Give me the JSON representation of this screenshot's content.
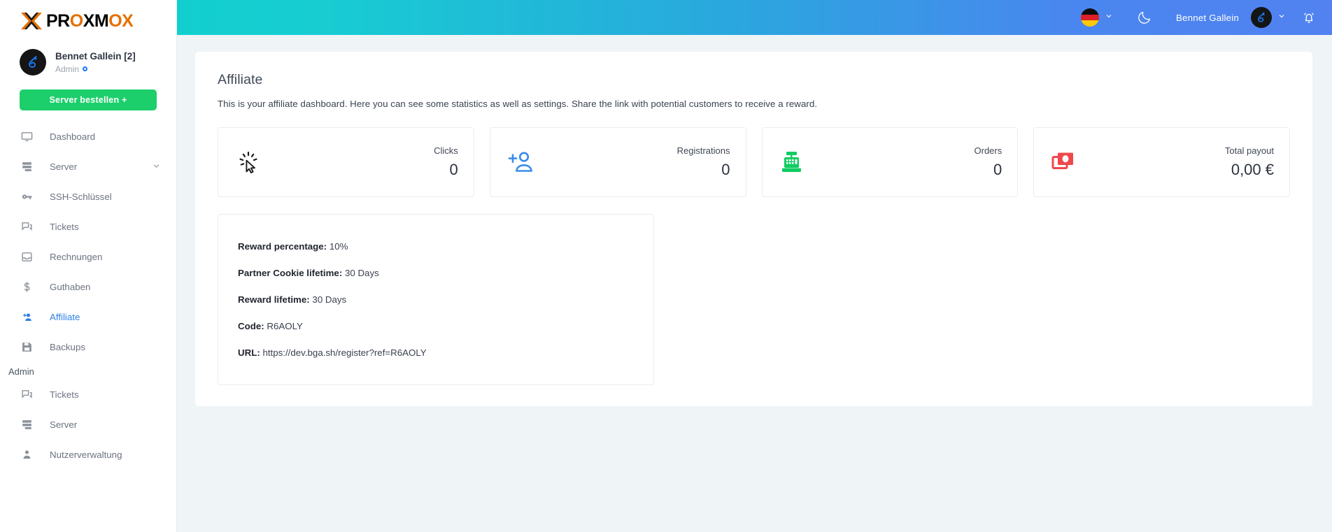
{
  "brand": {
    "logo_text_parts": [
      "PR",
      "O",
      "XM",
      "O",
      "X"
    ],
    "logo_name": "PROXMOX"
  },
  "sidebar": {
    "user": {
      "name": "Bennet Gallein [2]",
      "role": "Admin"
    },
    "order_button": "Server bestellen +",
    "items": [
      {
        "label": "Dashboard",
        "icon": "monitor-icon",
        "active": false,
        "chevron": false
      },
      {
        "label": "Server",
        "icon": "server-icon",
        "active": false,
        "chevron": true
      },
      {
        "label": "SSH-Schlüssel",
        "icon": "key-icon",
        "active": false,
        "chevron": false
      },
      {
        "label": "Tickets",
        "icon": "chat-icon",
        "active": false,
        "chevron": false
      },
      {
        "label": "Rechnungen",
        "icon": "inbox-icon",
        "active": false,
        "chevron": false
      },
      {
        "label": "Guthaben",
        "icon": "dollar-icon",
        "active": false,
        "chevron": false
      },
      {
        "label": "Affiliate",
        "icon": "person-add-icon",
        "active": true,
        "chevron": false
      },
      {
        "label": "Backups",
        "icon": "save-icon",
        "active": false,
        "chevron": false
      }
    ],
    "admin_section_label": "Admin",
    "admin_items": [
      {
        "label": "Tickets",
        "icon": "chat-icon"
      },
      {
        "label": "Server",
        "icon": "server-icon"
      },
      {
        "label": "Nutzerverwaltung",
        "icon": "people-icon"
      }
    ]
  },
  "topbar": {
    "language": "de",
    "theme_toggle": "dark-mode",
    "user_name": "Bennet Gallein",
    "notifications": "notifications-bell"
  },
  "main": {
    "title": "Affiliate",
    "description": "This is your affiliate dashboard. Here you can see some statistics as well as settings. Share the link with potential customers to receive a reward.",
    "stats": [
      {
        "label": "Clicks",
        "value": "0",
        "icon": "click-cursor-icon",
        "color": "#1c1c1c"
      },
      {
        "label": "Registrations",
        "value": "0",
        "icon": "person-add-icon",
        "color": "#3b8bea"
      },
      {
        "label": "Orders",
        "value": "0",
        "icon": "cash-register-icon",
        "color": "#12cc62"
      },
      {
        "label": "Total payout",
        "value": "0,00 €",
        "icon": "banknotes-icon",
        "color": "#f0474b"
      }
    ],
    "details": [
      {
        "label": "Reward percentage:",
        "value": "10%"
      },
      {
        "label": "Partner Cookie lifetime:",
        "value": "30 Days"
      },
      {
        "label": "Reward lifetime:",
        "value": "30 Days"
      },
      {
        "label": "Code:",
        "value": "R6AOLY"
      },
      {
        "label": "URL:",
        "value": "https://dev.bga.sh/register?ref=R6AOLY"
      }
    ]
  },
  "colors": {
    "accent_green": "#1ccf6b",
    "accent_blue": "#2f7fe8",
    "header_gradient_start": "#12cfcf",
    "header_gradient_end": "#5182f0",
    "page_bg": "#eff4f7"
  }
}
